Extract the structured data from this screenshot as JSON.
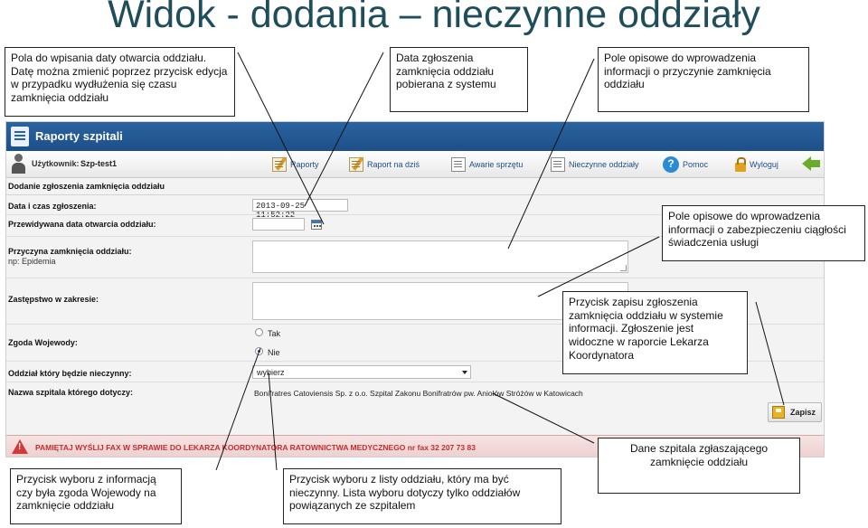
{
  "slide": {
    "title": "Widok - dodania – nieczynne oddziały"
  },
  "app": {
    "title": "Raporty szpitali",
    "user": {
      "label": "Użytkownik:",
      "name": "Szp-test1"
    },
    "toolbar": [
      {
        "label": "Raporty",
        "icon": "report-pencil-icon"
      },
      {
        "label": "Raport na dziś",
        "icon": "report-today-icon"
      },
      {
        "label": "Awarie sprzętu",
        "icon": "equipment-failure-icon"
      },
      {
        "label": "Nieczynne oddziały",
        "icon": "closed-wards-icon"
      },
      {
        "label": "Pomoc",
        "icon": "help-icon"
      },
      {
        "label": "Wyloguj",
        "icon": "lock-icon"
      }
    ],
    "form": {
      "title": "Dodanie zgłoszenia zamknięcia oddziału",
      "fields": {
        "datetime_label": "Data i czas zgłoszenia:",
        "datetime_value": "2013-09-25 11:52:22",
        "expected_open_label": "Przewidywana data otwarcia oddziału:",
        "expected_open_value": "",
        "reason_label": "Przyczyna zamknięcia oddziału:",
        "reason_hint": "np: Epidemia",
        "substitute_label": "Zastępstwo w zakresie:",
        "voivode_label": "Zgoda Wojewody:",
        "voivode_yes": "Tak",
        "voivode_no": "Nie",
        "voivode_selected": "Nie",
        "ward_label": "Oddział który będzie nieczynny:",
        "ward_value": "wybierz",
        "hospital_label": "Nazwa szpitala którego dotyczy:",
        "hospital_value": "Bonifratres Catoviensis Sp. z o.o. Szpital Zakonu Bonifratrów pw. Aniołów Stróżów w Katowicach"
      },
      "save_label": "Zapisz",
      "fax_notice": "PAMIĘTAJ WYŚLIJ FAX W SPRAWIE DO LEKARZA KOORDYNATORA RATOWNICTWA MEDYCZNEGO nr fax 32 207 73 83"
    }
  },
  "callouts": {
    "c1": "Pola do wpisania daty otwarcia oddziału. Datę można zmienić poprzez przycisk edycja w przypadku wydłużenia się czasu zamknięcia oddziału",
    "c2": "Data zgłoszenia zamknięcia oddziału pobierana z systemu",
    "c3": "Pole opisowe do wprowadzenia informacji o przyczynie zamknięcia oddziału",
    "c4": "Pole opisowe do wprowadzenia informacji o zabezpieczeniu ciągłości świadczenia usługi",
    "c5": "Przycisk zapisu zgłoszenia zamknięcia oddziału w systemie informacji. Zgłoszenie jest widoczne w raporcie Lekarza Koordynatora",
    "c6": "Dane szpitala zgłaszającego zamknięcie oddziału",
    "c7": "Przycisk wyboru z informacją czy była zgoda Wojewody na zamknięcie oddziału",
    "c8": "Przycisk wyboru z listy oddziału, który ma być nieczynny. Lista wyboru dotyczy tylko oddziałów powiązanych ze szpitalem"
  }
}
